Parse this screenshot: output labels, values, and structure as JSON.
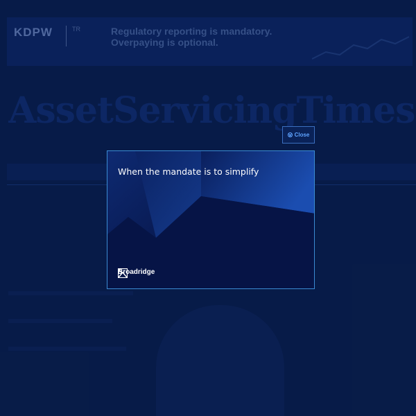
{
  "background": {
    "ad": {
      "logo": "KDPW",
      "logo_sub": "TR",
      "headline_line1": "Regulatory reporting is mandatory.",
      "headline_line2": "Overpaying is optional."
    },
    "masthead": "AssetServicingTimes"
  },
  "modal": {
    "close_label": "Close",
    "title": "When the mandate is to simplify",
    "brand": "Broadridge"
  },
  "colors": {
    "page_bg": "#081d4a",
    "modal_border": "#3b8cd4",
    "close_accent": "#5ea3ff"
  }
}
